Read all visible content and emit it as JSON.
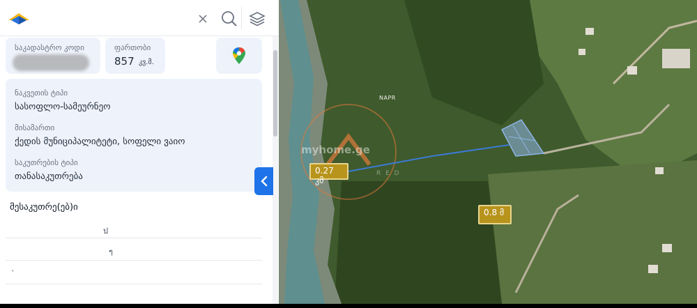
{
  "search": {
    "value": "",
    "placeholder": ""
  },
  "cadastral": {
    "label": "საკადასტრო კოდი"
  },
  "area": {
    "label": "ფართობი",
    "value": "857",
    "unit": "კვ.მ."
  },
  "info": {
    "land_type_label": "ნაკვეთის ტიპი",
    "land_type_value": "სასოფლო-სამეურნეო",
    "address_label": "მისამართი",
    "address_value": "ქედის მუნიციპალიტეტი, სოფელი ვაიო",
    "ownership_label": "საკუთრების ტიპი",
    "ownership_value": "თანასაკუთრება"
  },
  "owners": {
    "title": "მესაკუთრე(ებ)ი",
    "rows": [
      "ป",
      "ๆ",
      "ˋ",
      ""
    ]
  },
  "map": {
    "label_1": "0.27 კმ",
    "label_2": "0.8 მ",
    "place": "NAPR",
    "watermark": "myhome.ge",
    "watermark_sub": "R E D"
  },
  "colors": {
    "accent": "#1e73e8",
    "card_bg": "#eef3fb",
    "label_bg": "#b8941d",
    "parcel": "#8fb6e8"
  },
  "icons": [
    "logo-icon",
    "close-icon",
    "search-icon",
    "layers-icon",
    "google-maps-icon",
    "chevron-left-icon"
  ]
}
